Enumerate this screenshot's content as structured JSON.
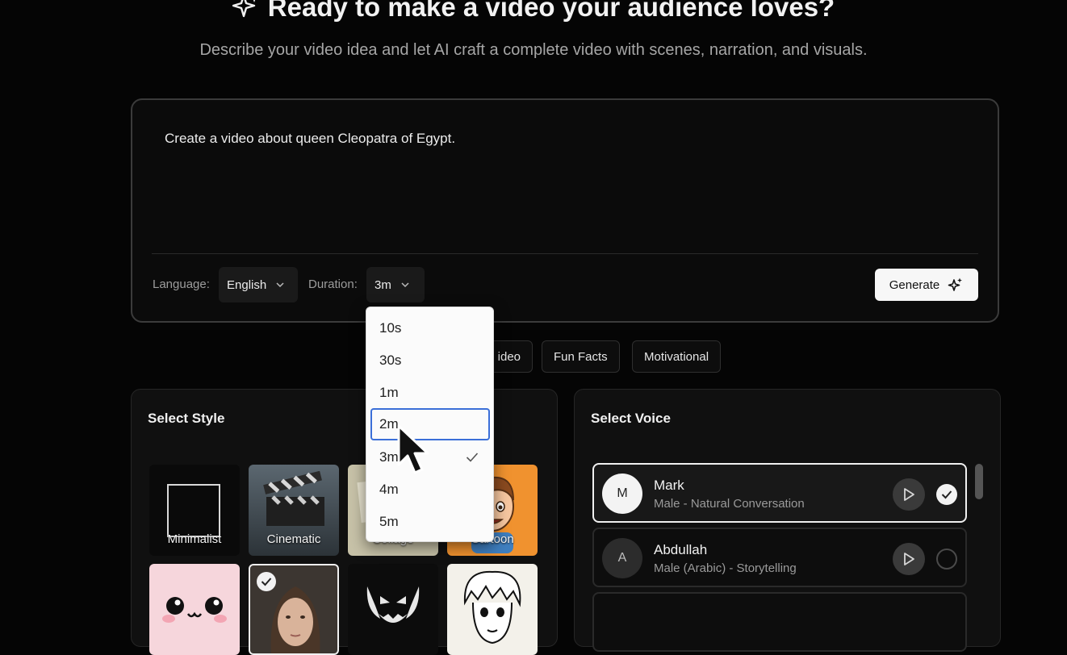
{
  "hero": {
    "title": "Ready to make a video your audience loves?",
    "subtitle": "Describe your video idea and let AI craft a complete video with scenes, narration, and visuals."
  },
  "prompt": {
    "text": "Create a video about queen Cleopatra of Egypt."
  },
  "controls": {
    "language_label": "Language:",
    "language_value": "English",
    "duration_label": "Duration:",
    "duration_value": "3m",
    "generate_label": "Generate"
  },
  "chips": [
    "ideo",
    "Fun Facts",
    "Motivational"
  ],
  "style_panel": {
    "title": "Select Style",
    "tiles": [
      {
        "label": "Minimalist"
      },
      {
        "label": "Cinematic"
      },
      {
        "label": "Collage"
      },
      {
        "label": "Cartoon"
      }
    ]
  },
  "voice_panel": {
    "title": "Select Voice",
    "voices": [
      {
        "initial": "M",
        "name": "Mark",
        "desc": "Male - Natural Conversation",
        "selected": true
      },
      {
        "initial": "A",
        "name": "Abdullah",
        "desc": "Male (Arabic) - Storytelling",
        "selected": false
      }
    ]
  },
  "duration_dropdown": {
    "options": [
      "10s",
      "30s",
      "1m",
      "2m",
      "3m",
      "4m",
      "5m"
    ],
    "hovered": "2m",
    "checked": "3m"
  },
  "icons": {
    "hero": "sparkle-icon",
    "select": "chevron-down-icon",
    "generate": "sparkles-icon",
    "play": "play-icon",
    "check": "check-icon",
    "cursor": "mouse-pointer-icon"
  },
  "colors": {
    "background": "#050505",
    "hover_outline": "#3b6fd8",
    "cartoon_bg": "#f0922f"
  }
}
